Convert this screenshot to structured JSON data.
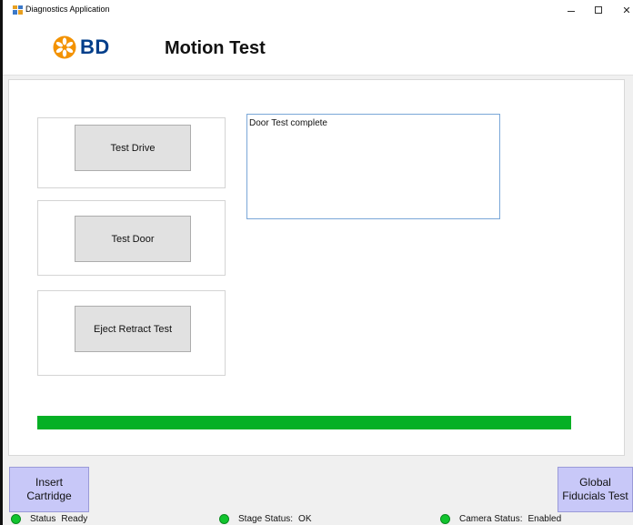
{
  "window": {
    "title": "Diagnostics Application",
    "controls": {
      "minimize": "–",
      "maximize": "☐",
      "close": "✕"
    }
  },
  "header": {
    "logo_text": "BD",
    "page_title": "Motion Test",
    "brand_colors": {
      "logo_orange": "#f39200",
      "logo_blue": "#003e8a"
    }
  },
  "actions": [
    {
      "label": "Test Drive"
    },
    {
      "label": "Test Door"
    },
    {
      "label": "Eject Retract Test"
    }
  ],
  "output": {
    "text": "Door Test complete"
  },
  "progress": {
    "percent": 100,
    "color": "#06b025"
  },
  "buttons": {
    "insert_cartridge": "Insert\nCartridge",
    "global_fiducials": "Global\nFiducials Test"
  },
  "statusbar": {
    "status": {
      "label": "Status",
      "value": "Ready"
    },
    "stage": {
      "label": "Stage Status:",
      "value": "OK"
    },
    "camera": {
      "label": "Camera Status:",
      "value": "Enabled"
    },
    "led_color": "#11c42e"
  }
}
